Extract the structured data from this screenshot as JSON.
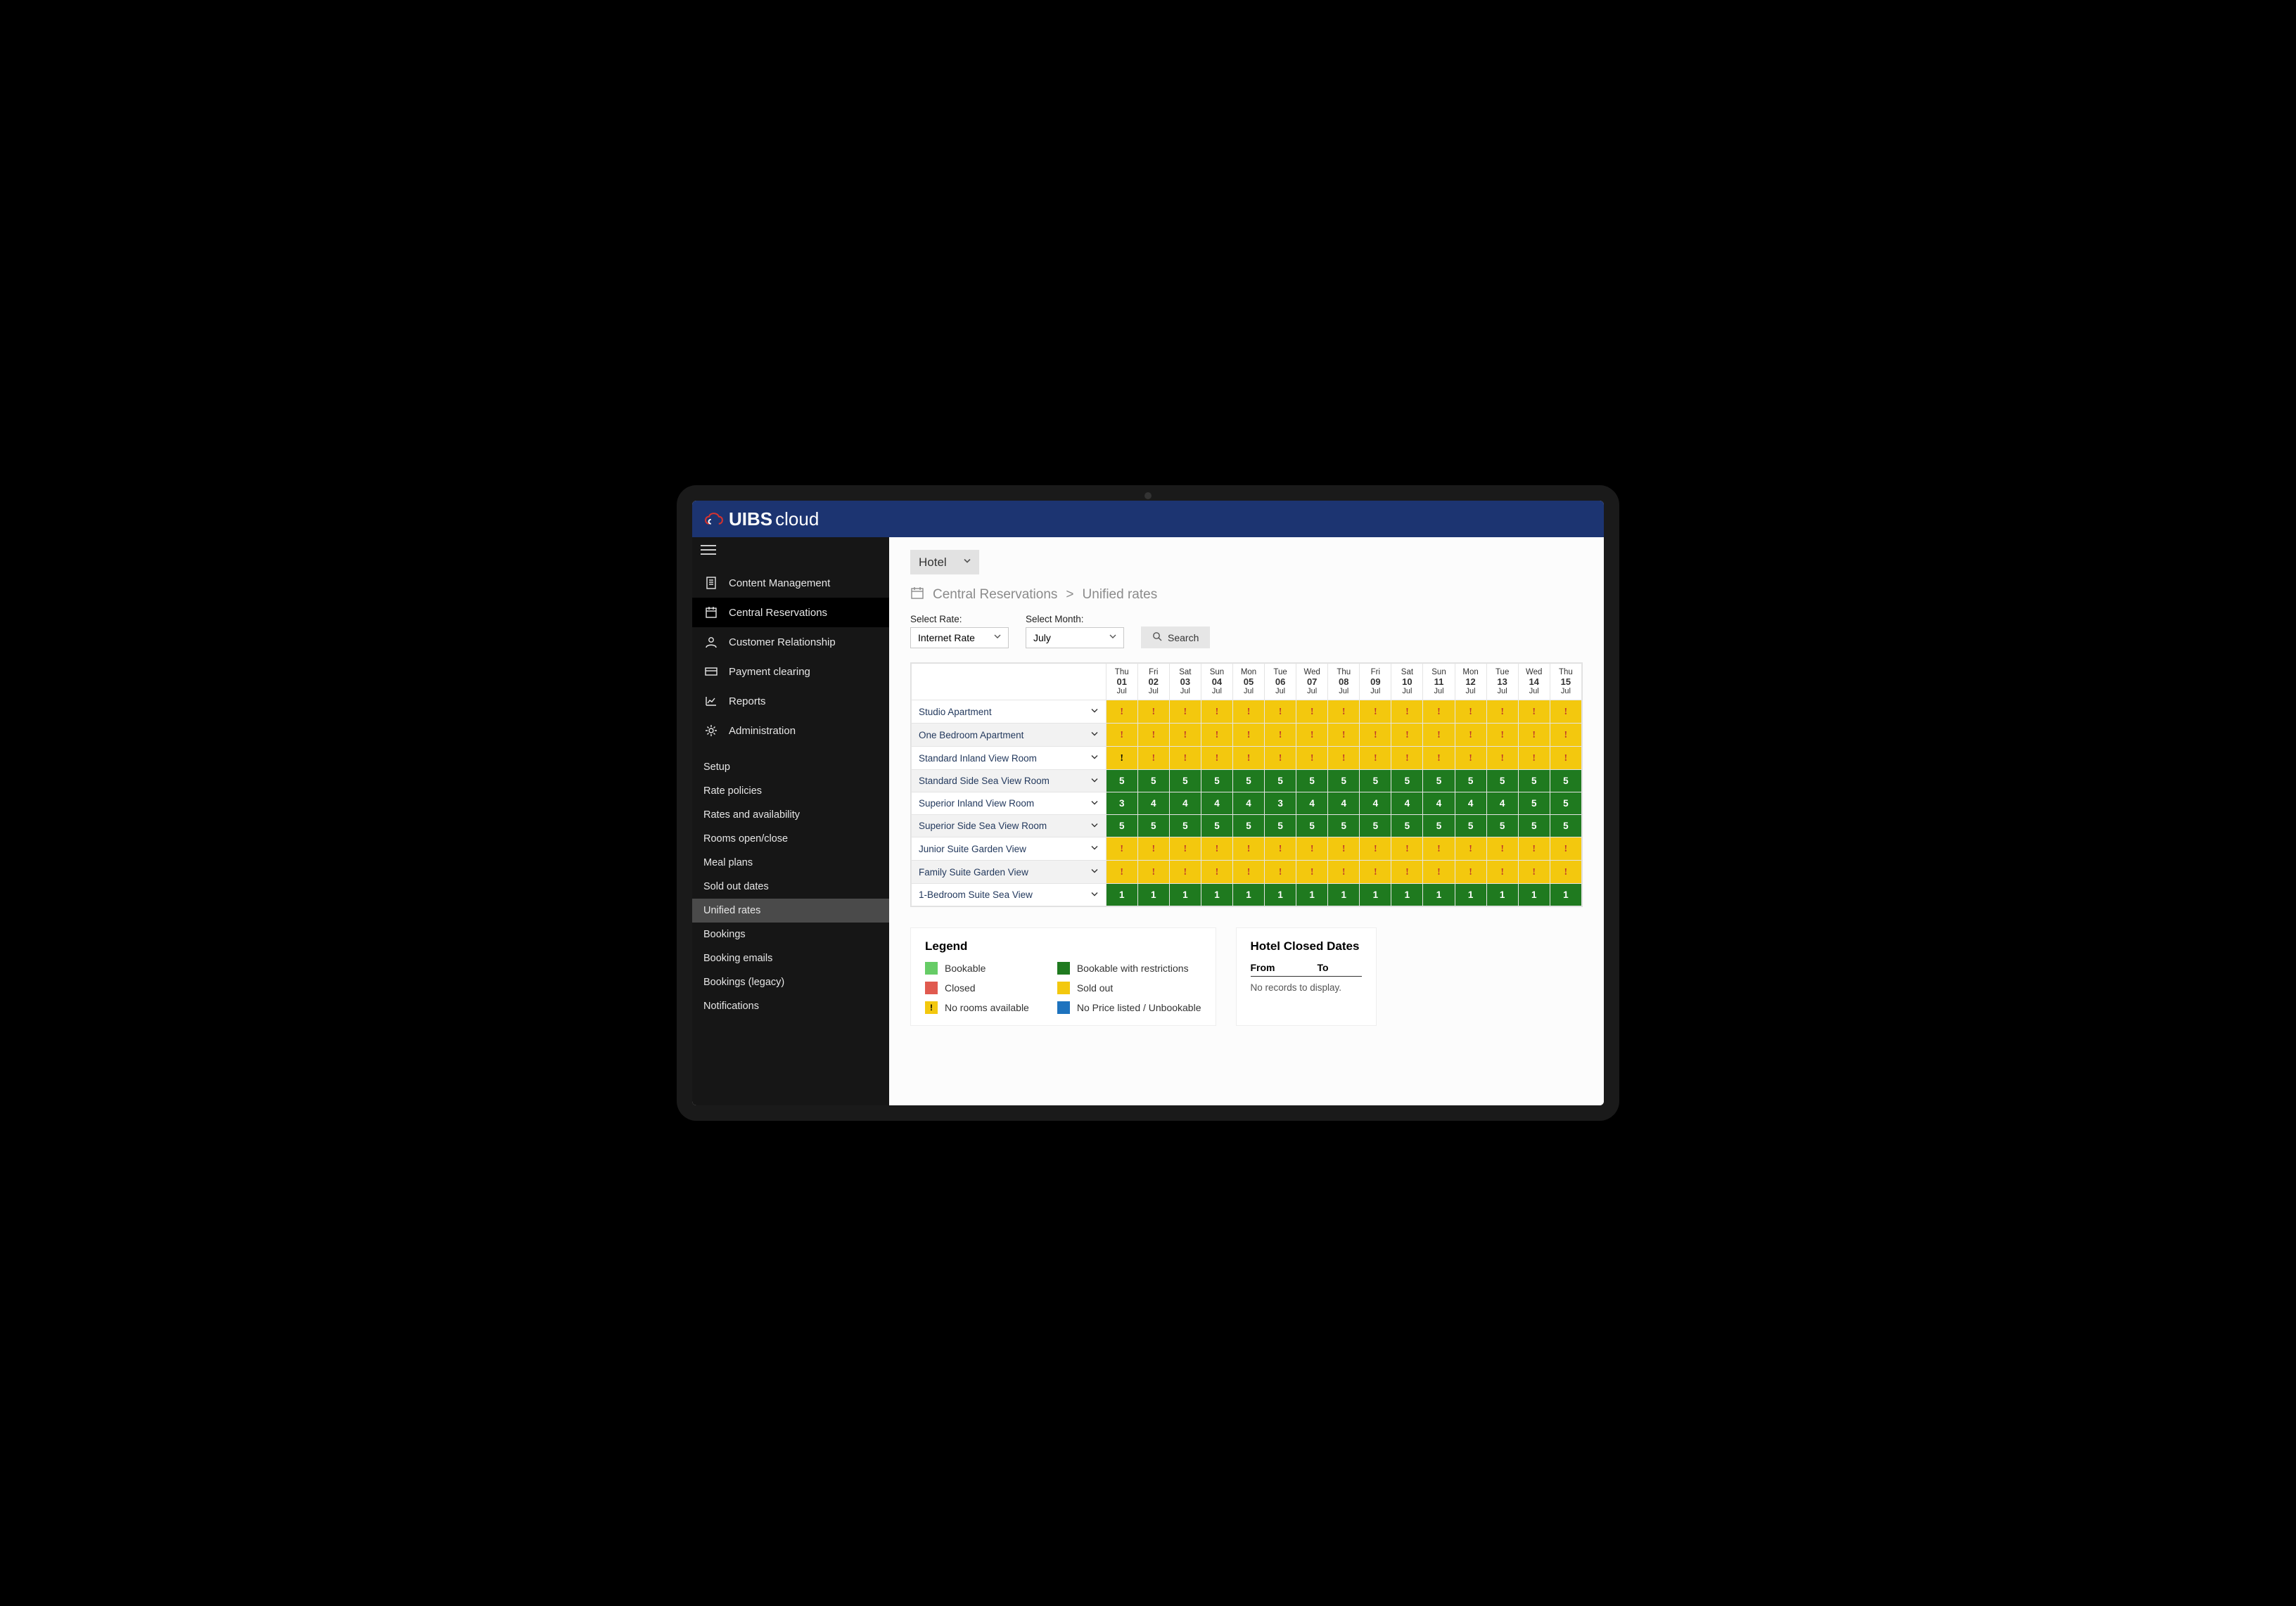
{
  "brand": {
    "bold": "UIBS",
    "thin": "cloud"
  },
  "nav": {
    "main": [
      {
        "label": "Content Management",
        "icon": "doc"
      },
      {
        "label": "Central Reservations",
        "icon": "booking",
        "active": true
      },
      {
        "label": "Customer Relationship",
        "icon": "user"
      },
      {
        "label": "Payment clearing",
        "icon": "card"
      },
      {
        "label": "Reports",
        "icon": "chart"
      },
      {
        "label": "Administration",
        "icon": "gear"
      }
    ],
    "sub": [
      {
        "label": "Setup"
      },
      {
        "label": "Rate policies"
      },
      {
        "label": "Rates and availability"
      },
      {
        "label": "Rooms open/close"
      },
      {
        "label": "Meal plans"
      },
      {
        "label": "Sold out dates"
      },
      {
        "label": "Unified rates",
        "active": true
      },
      {
        "label": "Bookings"
      },
      {
        "label": "Booking emails"
      },
      {
        "label": "Bookings (legacy)"
      },
      {
        "label": "Notifications"
      }
    ]
  },
  "hotel_select": "Hotel",
  "breadcrumb": {
    "root": "Central Reservations",
    "sep": ">",
    "leaf": "Unified rates"
  },
  "filters": {
    "rate_label": "Select Rate:",
    "rate_value": "Internet Rate",
    "month_label": "Select Month:",
    "month_value": "July",
    "search": "Search"
  },
  "days": [
    {
      "dow": "Thu",
      "num": "01",
      "mon": "Jul"
    },
    {
      "dow": "Fri",
      "num": "02",
      "mon": "Jul"
    },
    {
      "dow": "Sat",
      "num": "03",
      "mon": "Jul"
    },
    {
      "dow": "Sun",
      "num": "04",
      "mon": "Jul"
    },
    {
      "dow": "Mon",
      "num": "05",
      "mon": "Jul"
    },
    {
      "dow": "Tue",
      "num": "06",
      "mon": "Jul"
    },
    {
      "dow": "Wed",
      "num": "07",
      "mon": "Jul"
    },
    {
      "dow": "Thu",
      "num": "08",
      "mon": "Jul"
    },
    {
      "dow": "Fri",
      "num": "09",
      "mon": "Jul"
    },
    {
      "dow": "Sat",
      "num": "10",
      "mon": "Jul"
    },
    {
      "dow": "Sun",
      "num": "11",
      "mon": "Jul"
    },
    {
      "dow": "Mon",
      "num": "12",
      "mon": "Jul"
    },
    {
      "dow": "Tue",
      "num": "13",
      "mon": "Jul"
    },
    {
      "dow": "Wed",
      "num": "14",
      "mon": "Jul"
    },
    {
      "dow": "Thu",
      "num": "15",
      "mon": "Jul"
    }
  ],
  "rows": [
    {
      "name": "Studio Apartment",
      "alt": false,
      "cells": [
        {
          "t": "w",
          "c": "r"
        },
        {
          "t": "w",
          "c": "r"
        },
        {
          "t": "w",
          "c": "r"
        },
        {
          "t": "w",
          "c": "r"
        },
        {
          "t": "w",
          "c": "r"
        },
        {
          "t": "w",
          "c": "r"
        },
        {
          "t": "w",
          "c": "r"
        },
        {
          "t": "w",
          "c": "r"
        },
        {
          "t": "w",
          "c": "r"
        },
        {
          "t": "w",
          "c": "r"
        },
        {
          "t": "w",
          "c": "r"
        },
        {
          "t": "w",
          "c": "r"
        },
        {
          "t": "w",
          "c": "r"
        },
        {
          "t": "w",
          "c": "r"
        },
        {
          "t": "w",
          "c": "r"
        }
      ]
    },
    {
      "name": "One Bedroom Apartment",
      "alt": true,
      "cells": [
        {
          "t": "w",
          "c": "r"
        },
        {
          "t": "w",
          "c": "r"
        },
        {
          "t": "w",
          "c": "r"
        },
        {
          "t": "w",
          "c": "r"
        },
        {
          "t": "w",
          "c": "r"
        },
        {
          "t": "w",
          "c": "r"
        },
        {
          "t": "w",
          "c": "r"
        },
        {
          "t": "w",
          "c": "r"
        },
        {
          "t": "w",
          "c": "r"
        },
        {
          "t": "w",
          "c": "r"
        },
        {
          "t": "w",
          "c": "r"
        },
        {
          "t": "w",
          "c": "r"
        },
        {
          "t": "w",
          "c": "r"
        },
        {
          "t": "w",
          "c": "r"
        },
        {
          "t": "w",
          "c": "r"
        }
      ]
    },
    {
      "name": "Standard Inland View Room",
      "alt": false,
      "cells": [
        {
          "t": "w",
          "c": "b"
        },
        {
          "t": "w",
          "c": "r"
        },
        {
          "t": "w",
          "c": "r"
        },
        {
          "t": "w",
          "c": "r"
        },
        {
          "t": "w",
          "c": "r"
        },
        {
          "t": "w",
          "c": "r"
        },
        {
          "t": "w",
          "c": "r"
        },
        {
          "t": "w",
          "c": "r"
        },
        {
          "t": "w",
          "c": "r"
        },
        {
          "t": "w",
          "c": "r"
        },
        {
          "t": "w",
          "c": "r"
        },
        {
          "t": "w",
          "c": "r"
        },
        {
          "t": "w",
          "c": "r"
        },
        {
          "t": "w",
          "c": "r"
        },
        {
          "t": "w",
          "c": "r"
        }
      ]
    },
    {
      "name": "Standard Side Sea View Room",
      "alt": true,
      "cells": [
        {
          "t": "n",
          "v": "5"
        },
        {
          "t": "n",
          "v": "5"
        },
        {
          "t": "n",
          "v": "5"
        },
        {
          "t": "n",
          "v": "5"
        },
        {
          "t": "n",
          "v": "5"
        },
        {
          "t": "n",
          "v": "5"
        },
        {
          "t": "n",
          "v": "5"
        },
        {
          "t": "n",
          "v": "5"
        },
        {
          "t": "n",
          "v": "5"
        },
        {
          "t": "n",
          "v": "5"
        },
        {
          "t": "n",
          "v": "5"
        },
        {
          "t": "n",
          "v": "5"
        },
        {
          "t": "n",
          "v": "5"
        },
        {
          "t": "n",
          "v": "5"
        },
        {
          "t": "n",
          "v": "5"
        }
      ]
    },
    {
      "name": "Superior Inland View Room",
      "alt": false,
      "cells": [
        {
          "t": "n",
          "v": "3"
        },
        {
          "t": "n",
          "v": "4"
        },
        {
          "t": "n",
          "v": "4"
        },
        {
          "t": "n",
          "v": "4"
        },
        {
          "t": "n",
          "v": "4"
        },
        {
          "t": "n",
          "v": "3"
        },
        {
          "t": "n",
          "v": "4"
        },
        {
          "t": "n",
          "v": "4"
        },
        {
          "t": "n",
          "v": "4"
        },
        {
          "t": "n",
          "v": "4"
        },
        {
          "t": "n",
          "v": "4"
        },
        {
          "t": "n",
          "v": "4"
        },
        {
          "t": "n",
          "v": "4"
        },
        {
          "t": "n",
          "v": "5"
        },
        {
          "t": "n",
          "v": "5"
        }
      ]
    },
    {
      "name": "Superior Side Sea View Room",
      "alt": true,
      "cells": [
        {
          "t": "n",
          "v": "5"
        },
        {
          "t": "n",
          "v": "5"
        },
        {
          "t": "n",
          "v": "5"
        },
        {
          "t": "n",
          "v": "5"
        },
        {
          "t": "n",
          "v": "5"
        },
        {
          "t": "n",
          "v": "5"
        },
        {
          "t": "n",
          "v": "5"
        },
        {
          "t": "n",
          "v": "5"
        },
        {
          "t": "n",
          "v": "5"
        },
        {
          "t": "n",
          "v": "5"
        },
        {
          "t": "n",
          "v": "5"
        },
        {
          "t": "n",
          "v": "5"
        },
        {
          "t": "n",
          "v": "5"
        },
        {
          "t": "n",
          "v": "5"
        },
        {
          "t": "n",
          "v": "5"
        }
      ]
    },
    {
      "name": "Junior Suite Garden View",
      "alt": false,
      "cells": [
        {
          "t": "w",
          "c": "r"
        },
        {
          "t": "w",
          "c": "r"
        },
        {
          "t": "w",
          "c": "r"
        },
        {
          "t": "w",
          "c": "r"
        },
        {
          "t": "w",
          "c": "r"
        },
        {
          "t": "w",
          "c": "r"
        },
        {
          "t": "w",
          "c": "r"
        },
        {
          "t": "w",
          "c": "r"
        },
        {
          "t": "w",
          "c": "r"
        },
        {
          "t": "w",
          "c": "r"
        },
        {
          "t": "w",
          "c": "r"
        },
        {
          "t": "w",
          "c": "r"
        },
        {
          "t": "w",
          "c": "r"
        },
        {
          "t": "w",
          "c": "r"
        },
        {
          "t": "w",
          "c": "r"
        }
      ]
    },
    {
      "name": "Family Suite Garden View",
      "alt": true,
      "cells": [
        {
          "t": "w",
          "c": "r"
        },
        {
          "t": "w",
          "c": "r"
        },
        {
          "t": "w",
          "c": "r"
        },
        {
          "t": "w",
          "c": "r"
        },
        {
          "t": "w",
          "c": "r"
        },
        {
          "t": "w",
          "c": "r"
        },
        {
          "t": "w",
          "c": "r"
        },
        {
          "t": "w",
          "c": "r"
        },
        {
          "t": "w",
          "c": "r"
        },
        {
          "t": "w",
          "c": "r"
        },
        {
          "t": "w",
          "c": "r"
        },
        {
          "t": "w",
          "c": "r"
        },
        {
          "t": "w",
          "c": "r"
        },
        {
          "t": "w",
          "c": "r"
        },
        {
          "t": "w",
          "c": "r"
        }
      ]
    },
    {
      "name": "1-Bedroom Suite Sea View",
      "alt": false,
      "cells": [
        {
          "t": "n",
          "v": "1"
        },
        {
          "t": "n",
          "v": "1"
        },
        {
          "t": "n",
          "v": "1"
        },
        {
          "t": "n",
          "v": "1"
        },
        {
          "t": "n",
          "v": "1"
        },
        {
          "t": "n",
          "v": "1"
        },
        {
          "t": "n",
          "v": "1"
        },
        {
          "t": "n",
          "v": "1"
        },
        {
          "t": "n",
          "v": "1"
        },
        {
          "t": "n",
          "v": "1"
        },
        {
          "t": "n",
          "v": "1"
        },
        {
          "t": "n",
          "v": "1"
        },
        {
          "t": "n",
          "v": "1"
        },
        {
          "t": "n",
          "v": "1"
        },
        {
          "t": "n",
          "v": "1"
        }
      ]
    }
  ],
  "legend": {
    "title": "Legend",
    "items": [
      {
        "label": "Bookable",
        "color": "#66cc66"
      },
      {
        "label": "Bookable with restrictions",
        "color": "#1f7a1f"
      },
      {
        "label": "Closed",
        "color": "#e05a4f"
      },
      {
        "label": "Sold out",
        "color": "#f3c80e"
      },
      {
        "label": "No rooms available",
        "color": "#f3c80e",
        "mark": "!"
      },
      {
        "label": "No Price listed / Unbookable",
        "color": "#1e73be"
      }
    ]
  },
  "closed": {
    "title": "Hotel Closed Dates",
    "from": "From",
    "to": "To",
    "empty": "No records to display."
  }
}
